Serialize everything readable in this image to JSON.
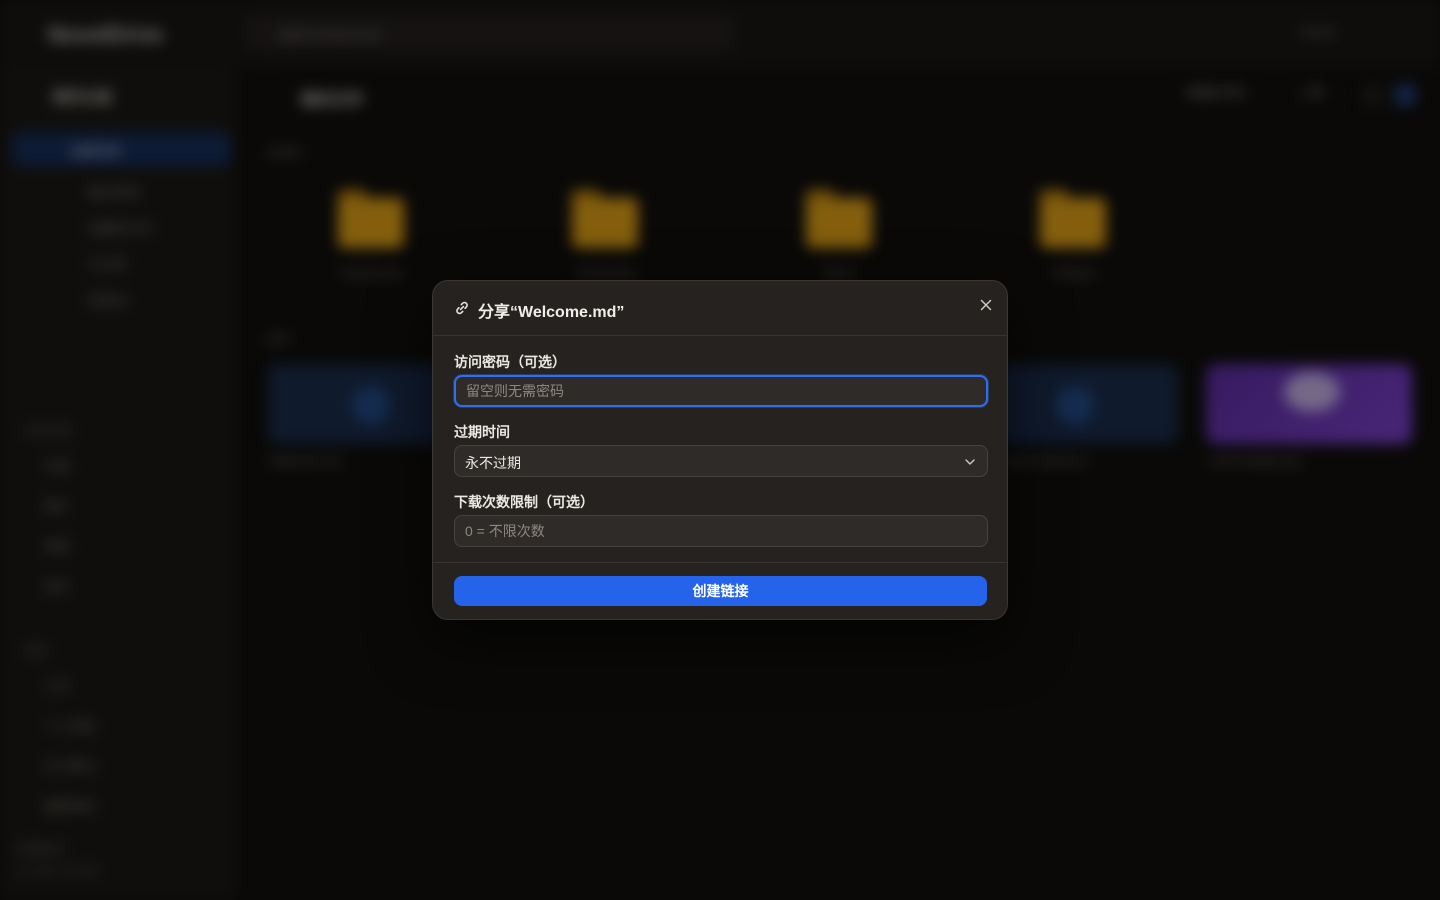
{
  "background": {
    "brand": "NovelDrive",
    "search_placeholder": "搜索文件和文件夹",
    "user_label": "Guest",
    "sidebar": {
      "header": "我的云盘",
      "active_item": "全部文件",
      "items": [
        "最近使用",
        "收藏的文件",
        "已分享",
        "回收站"
      ],
      "section_one": "文件分类",
      "section_one_items": [
        "文档",
        "图片",
        "视频",
        "音乐"
      ],
      "section_two": "标签",
      "section_two_items": [
        "工作",
        "个人项目",
        "学习笔记",
        "重要资料"
      ],
      "storage_label": "存储空间",
      "storage_value": "1.2 GB / 10 GB"
    },
    "main": {
      "title": "我的文件",
      "new_button": "新建文件夹",
      "upload_button": "上传",
      "folders_section": "文件夹",
      "folders": [
        {
          "name": "Documents",
          "meta": "12 项"
        },
        {
          "name": "Downloads",
          "meta": "5 项"
        },
        {
          "name": "Music",
          "meta": "8 项"
        },
        {
          "name": "Pictures",
          "meta": "24 项"
        }
      ],
      "files_section": "文件",
      "files": [
        {
          "name": "Welcome.md",
          "meta": "2 KB"
        },
        {
          "name": "report-draft.docx",
          "meta": "48 KB"
        },
        {
          "name": "cover-design.png",
          "meta": "1.1 MB"
        }
      ]
    }
  },
  "modal": {
    "title": "分享“Welcome.md”",
    "close_icon": "close-icon",
    "link_icon": "link-icon",
    "password": {
      "label": "访问密码（可选）",
      "placeholder": "留空则无需密码",
      "value": ""
    },
    "expiry": {
      "label": "过期时间",
      "selected": "永不过期"
    },
    "download_limit": {
      "label": "下载次数限制（可选）",
      "placeholder": "0 = 不限次数",
      "value": ""
    },
    "submit_label": "创建链接",
    "colors": {
      "accent": "#2563eb",
      "focus_ring": "#2f6ef0",
      "surface": "#252220",
      "field": "#2f2b28"
    }
  }
}
